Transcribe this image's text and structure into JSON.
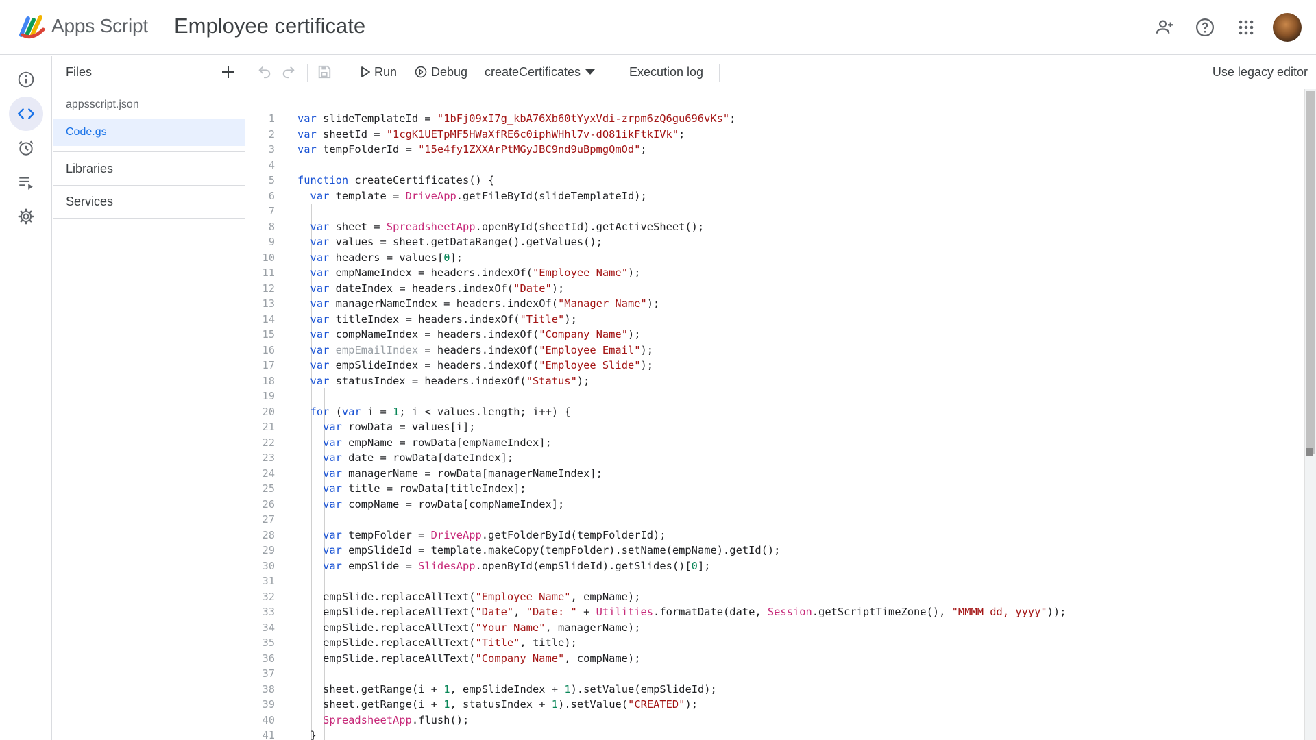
{
  "header": {
    "product_name": "Apps Script",
    "project_title": "Employee certificate",
    "icons": [
      "add-person-icon",
      "help-icon",
      "apps-grid-icon",
      "avatar"
    ]
  },
  "rail": {
    "items": [
      {
        "name": "info-icon",
        "active": false
      },
      {
        "name": "code-editor-icon",
        "active": true
      },
      {
        "name": "alarm-clock-icon",
        "active": false
      },
      {
        "name": "executions-icon",
        "active": false
      },
      {
        "name": "gear-icon",
        "active": false
      }
    ]
  },
  "files_panel": {
    "title": "Files",
    "files": [
      "appsscript.json",
      "Code.gs"
    ],
    "active_file": "Code.gs",
    "sections": [
      "Libraries",
      "Services"
    ]
  },
  "toolbar": {
    "run": "Run",
    "debug": "Debug",
    "function_select": "createCertificates",
    "execution_log": "Execution log",
    "legacy": "Use legacy editor"
  },
  "colors": {
    "accent": "#1a73e8",
    "keyword": "#1a53d4",
    "string": "#a31515",
    "number": "#098658",
    "builtin": "#c62878"
  },
  "code": {
    "lines": [
      "var slideTemplateId = \"1bFj09xI7g_kbA76Xb60tYyxVdi-zrpm6zQ6gu696vKs\";",
      "var sheetId = \"1cgK1UETpMF5HWaXfRE6c0iphWHhl7v-dQ81ikFtkIVk\";",
      "var tempFolderId = \"15e4fy1ZXXArPtMGyJBC9nd9uBpmgQmOd\";",
      "",
      "function createCertificates() {",
      "  var template = DriveApp.getFileById(slideTemplateId);",
      "",
      "  var sheet = SpreadsheetApp.openById(sheetId).getActiveSheet();",
      "  var values = sheet.getDataRange().getValues();",
      "  var headers = values[0];",
      "  var empNameIndex = headers.indexOf(\"Employee Name\");",
      "  var dateIndex = headers.indexOf(\"Date\");",
      "  var managerNameIndex = headers.indexOf(\"Manager Name\");",
      "  var titleIndex = headers.indexOf(\"Title\");",
      "  var compNameIndex = headers.indexOf(\"Company Name\");",
      "  var empEmailIndex = headers.indexOf(\"Employee Email\");",
      "  var empSlideIndex = headers.indexOf(\"Employee Slide\");",
      "  var statusIndex = headers.indexOf(\"Status\");",
      "",
      "  for (var i = 1; i < values.length; i++) {",
      "    var rowData = values[i];",
      "    var empName = rowData[empNameIndex];",
      "    var date = rowData[dateIndex];",
      "    var managerName = rowData[managerNameIndex];",
      "    var title = rowData[titleIndex];",
      "    var compName = rowData[compNameIndex];",
      "",
      "    var tempFolder = DriveApp.getFolderById(tempFolderId);",
      "    var empSlideId = template.makeCopy(tempFolder).setName(empName).getId();",
      "    var empSlide = SlidesApp.openById(empSlideId).getSlides()[0];",
      "",
      "    empSlide.replaceAllText(\"Employee Name\", empName);",
      "    empSlide.replaceAllText(\"Date\", \"Date: \" + Utilities.formatDate(date, Session.getScriptTimeZone(), \"MMMM dd, yyyy\"));",
      "    empSlide.replaceAllText(\"Your Name\", managerName);",
      "    empSlide.replaceAllText(\"Title\", title);",
      "    empSlide.replaceAllText(\"Company Name\", compName);",
      "",
      "    sheet.getRange(i + 1, empSlideIndex + 1).setValue(empSlideId);",
      "    sheet.getRange(i + 1, statusIndex + 1).setValue(\"CREATED\");",
      "    SpreadsheetApp.flush();",
      "  }"
    ]
  }
}
